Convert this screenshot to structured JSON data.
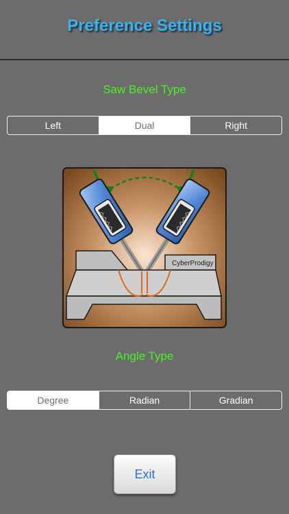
{
  "header": {
    "title": "Preference Settings"
  },
  "bevel": {
    "label": "Saw Bevel Type",
    "options": [
      "Left",
      "Dual",
      "Right"
    ],
    "selected": "Dual"
  },
  "illustration": {
    "brand_text": "CyberProdigy"
  },
  "angle": {
    "label": "Angle Type",
    "options": [
      "Degree",
      "Radian",
      "Gradian"
    ],
    "selected": "Degree"
  },
  "footer": {
    "exit_label": "Exit"
  },
  "colors": {
    "background": "#6c6c6c",
    "title": "#3fb0ea",
    "label": "#4cf029",
    "accent": "#2a6fd6"
  }
}
